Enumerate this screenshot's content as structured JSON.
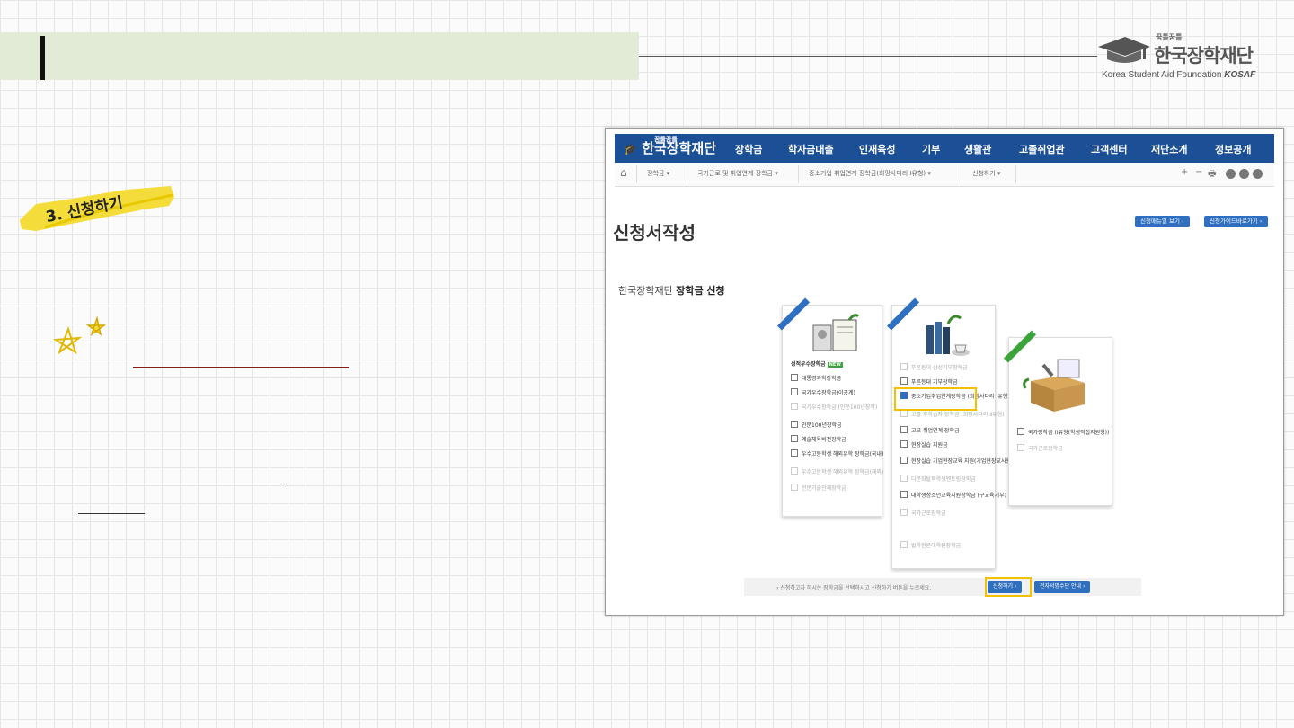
{
  "brand": {
    "tagline": "꿈틀꿈틀",
    "name_ko": "한국장학재단",
    "name_en": "Korea Student Aid Foundation",
    "acronym": "KOSAF"
  },
  "step_label": "3. 신청하기",
  "site": {
    "logo_tag": "꿈틀꿈틀",
    "logo_text": "한국장학재단",
    "nav": [
      "장학금",
      "학자금대출",
      "인재육성",
      "기부",
      "생활관",
      "고졸취업관",
      "고객센터",
      "재단소개",
      "정보공개"
    ],
    "breadcrumb": [
      "장학금",
      "국가근로 및 취업연계 장학금",
      "중소기업 취업연계 장학금(희망사다리 Ⅰ유형)",
      "신청하기"
    ],
    "tools": [
      "+",
      "−",
      "🖶"
    ],
    "page_title": "신청서작성",
    "top_buttons": [
      "신청매뉴얼 보기",
      "신청가이드바로가기"
    ],
    "section_prefix": "한국장학재단",
    "section_title": "장학금 신청",
    "card1": {
      "title": "성적우수장학금",
      "badge": "NEW",
      "items": [
        {
          "label": "대통령과학장학금",
          "sub": false
        },
        {
          "label": "국가우수장학금(이공계)",
          "sub": false
        },
        {
          "label": "국가우수장학금 (인문100년장학)",
          "sub": true
        },
        {
          "label": "인문100년장학금",
          "sub": false
        },
        {
          "label": "예술체육비전장학금",
          "sub": false
        },
        {
          "label": "우수고등학생 해외유학 장학금(국내)",
          "sub": false
        },
        {
          "label": "우수고등학생 해외유학 장학금(해외)",
          "sub": true
        },
        {
          "label": "전문기술인재장학금",
          "sub": true
        }
      ]
    },
    "card2": {
      "items": [
        {
          "label": "푸른등대 삼성기부장학금",
          "sub": true,
          "checked": false
        },
        {
          "label": "푸른등대 기부장학금",
          "sub": false,
          "checked": false
        },
        {
          "label": "중소기업취업연계장학금 (희망사다리 Ⅰ유형)",
          "sub": false,
          "checked": true
        },
        {
          "label": "고졸 후학습자 장학금 (희망사다리 Ⅱ유형)",
          "sub": true,
          "checked": false
        },
        {
          "label": "고교 취업연계 장학금",
          "sub": false,
          "checked": false
        },
        {
          "label": "현장실습 지원금",
          "sub": false,
          "checked": false
        },
        {
          "label": "현장실습 기업현장교육 지원(기업현장교사용)",
          "sub": false,
          "checked": false
        },
        {
          "label": "다문화탈북학생멘토링장학금",
          "sub": true,
          "checked": false
        },
        {
          "label": "대학생청소년교육지원장학금 (구교육기부)",
          "sub": false,
          "checked": false
        },
        {
          "label": "국가근로장학금",
          "sub": true,
          "checked": false
        },
        {
          "label": "법학전문대학원장학금",
          "sub": true,
          "checked": false
        }
      ]
    },
    "card3": {
      "items": [
        {
          "label": "국가장학금 (Ⅰ유형(학생직접지원형))",
          "sub": false
        },
        {
          "label": "국가근로장학금",
          "sub": true
        }
      ]
    },
    "bottom_message": "신청하고자 하시는 장학금을 선택하시고 신청하기 버튼을 누르세요.",
    "apply_button": "신청하기",
    "guide_button": "전자서명수단 안내"
  },
  "colors": {
    "header_band": "#e1ebd6",
    "site_nav": "#1b4f96",
    "button_blue": "#2f6fbf",
    "highlight": "#f2c200",
    "underline": "#8b1a1a"
  }
}
